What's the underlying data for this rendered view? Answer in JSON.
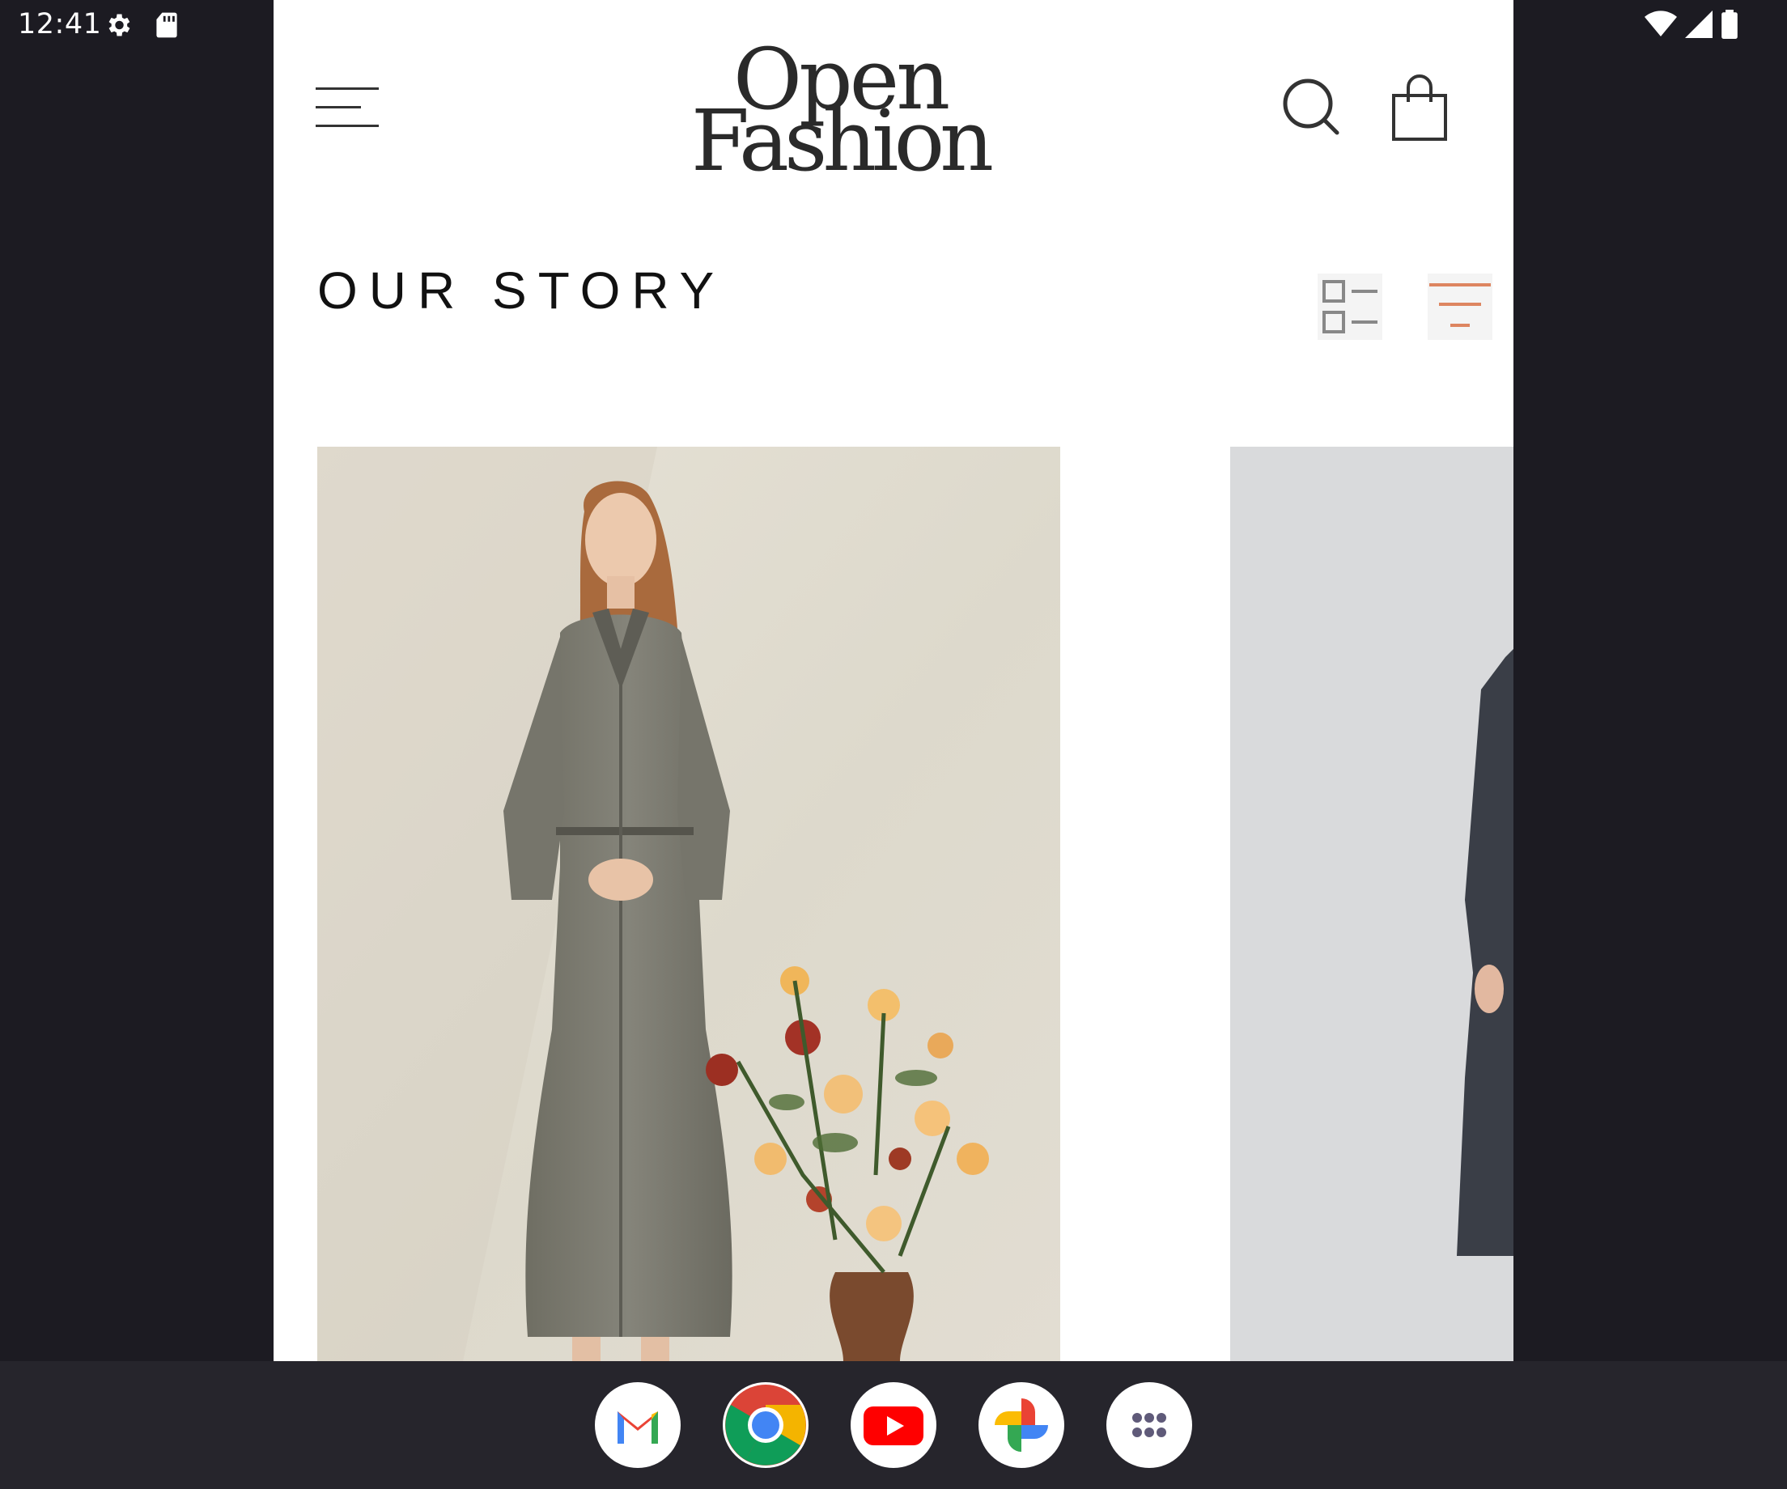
{
  "status_bar": {
    "time": "12:41",
    "icons": [
      "gear-icon",
      "sd-card-icon",
      "wifi-icon",
      "signal-icon",
      "battery-icon"
    ]
  },
  "header": {
    "logo_line1": "Open",
    "logo_line2": "Fashion",
    "menu_icon": "hamburger-menu-icon",
    "search_icon": "search-icon",
    "cart_icon": "shopping-bag-icon"
  },
  "section": {
    "title": "OUR STORY",
    "view_toggle_icon": "list-view-icon",
    "filter_icon": "filter-icon"
  },
  "colors": {
    "accent": "#dd8560",
    "icon_gray": "#888888",
    "background_dark": "#1c1b22",
    "dock": "#26252c"
  },
  "dock": {
    "apps": [
      "Gmail",
      "Chrome",
      "YouTube",
      "Photos",
      "App drawer"
    ]
  }
}
